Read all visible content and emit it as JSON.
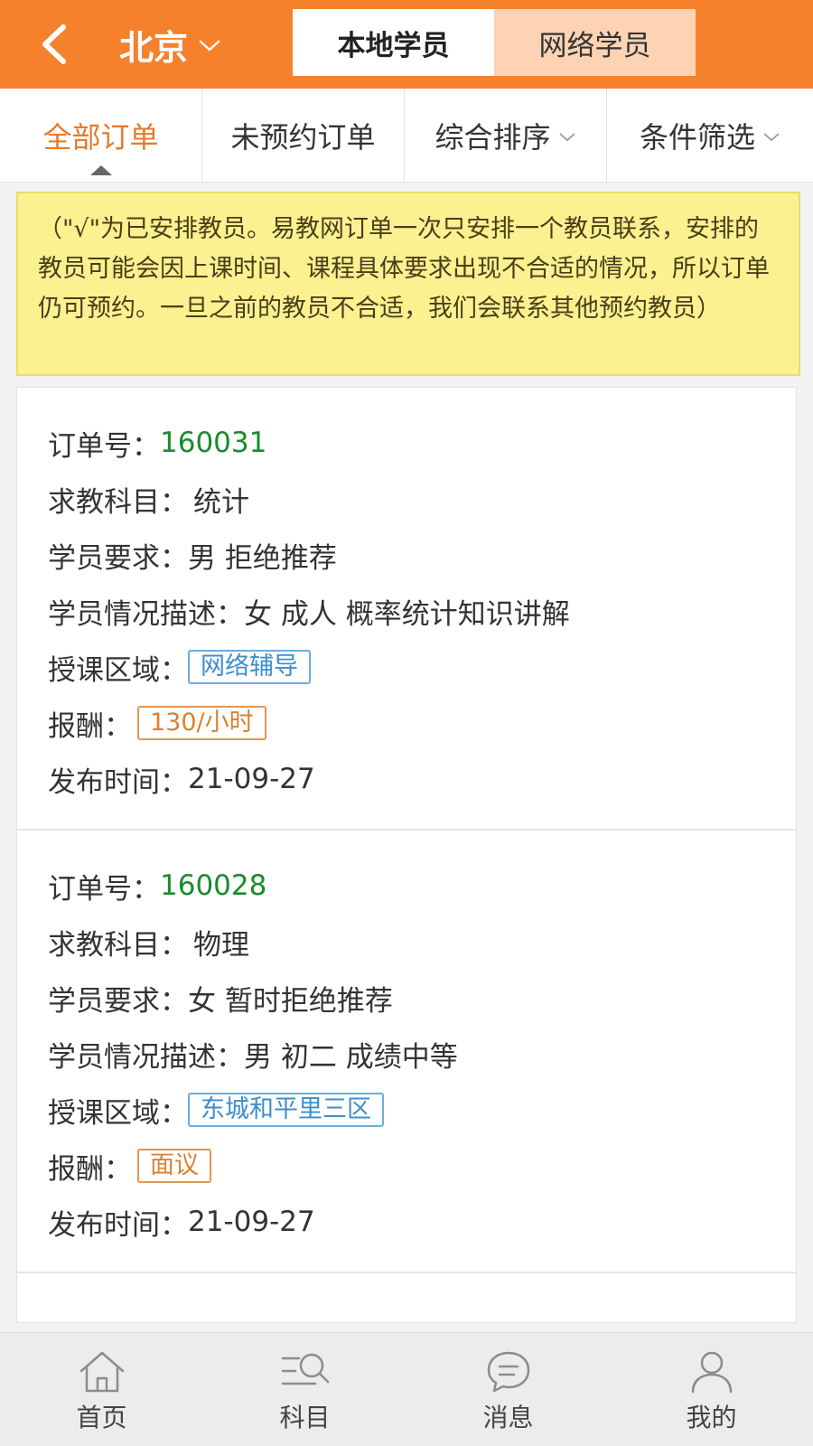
{
  "header": {
    "city": "北京",
    "segments": [
      "本地学员",
      "网络学员"
    ],
    "active_segment": "本地学员"
  },
  "tabs": [
    {
      "label": "全部订单",
      "active": true,
      "dropdown": false
    },
    {
      "label": "未预约订单",
      "active": false,
      "dropdown": false
    },
    {
      "label": "综合排序",
      "active": false,
      "dropdown": true
    },
    {
      "label": "条件筛选",
      "active": false,
      "dropdown": true
    }
  ],
  "notice": "（\"√\"为已安排教员。易教网订单一次只安排一个教员联系，安排的教员可能会因上课时间、课程具体要求出现不合适的情况，所以订单仍可预约。一旦之前的教员不合适，我们会联系其他预约教员）",
  "labels": {
    "order_no": "订单号：",
    "subject": "求教科目：",
    "requirement": "学员要求：",
    "description": "学员情况描述：",
    "area": "授课区域：",
    "pay": "报酬：",
    "published": "发布时间："
  },
  "orders": [
    {
      "order_no": "160031",
      "subject": "统计",
      "requirement": "男 拒绝推荐",
      "description": "女 成人 概率统计知识讲解",
      "area": "网络辅导",
      "pay": "130/小时",
      "published": "21-09-27"
    },
    {
      "order_no": "160028",
      "subject": "物理",
      "requirement": "女 暂时拒绝推荐",
      "description": "男 初二 成绩中等",
      "area": "东城和平里三区",
      "pay": "面议",
      "published": "21-09-27"
    }
  ],
  "bottom_nav": [
    {
      "label": "首页",
      "icon": "home-icon"
    },
    {
      "label": "科目",
      "icon": "subject-search-icon"
    },
    {
      "label": "消息",
      "icon": "message-icon"
    },
    {
      "label": "我的",
      "icon": "user-icon"
    }
  ],
  "colors": {
    "brand_orange": "#f5812c",
    "active_tab": "#e8792a",
    "order_no": "#1a8b2e",
    "area_tag": "#3d8ec9",
    "pay_tag": "#d9822e",
    "notice_bg": "#fbf191"
  }
}
